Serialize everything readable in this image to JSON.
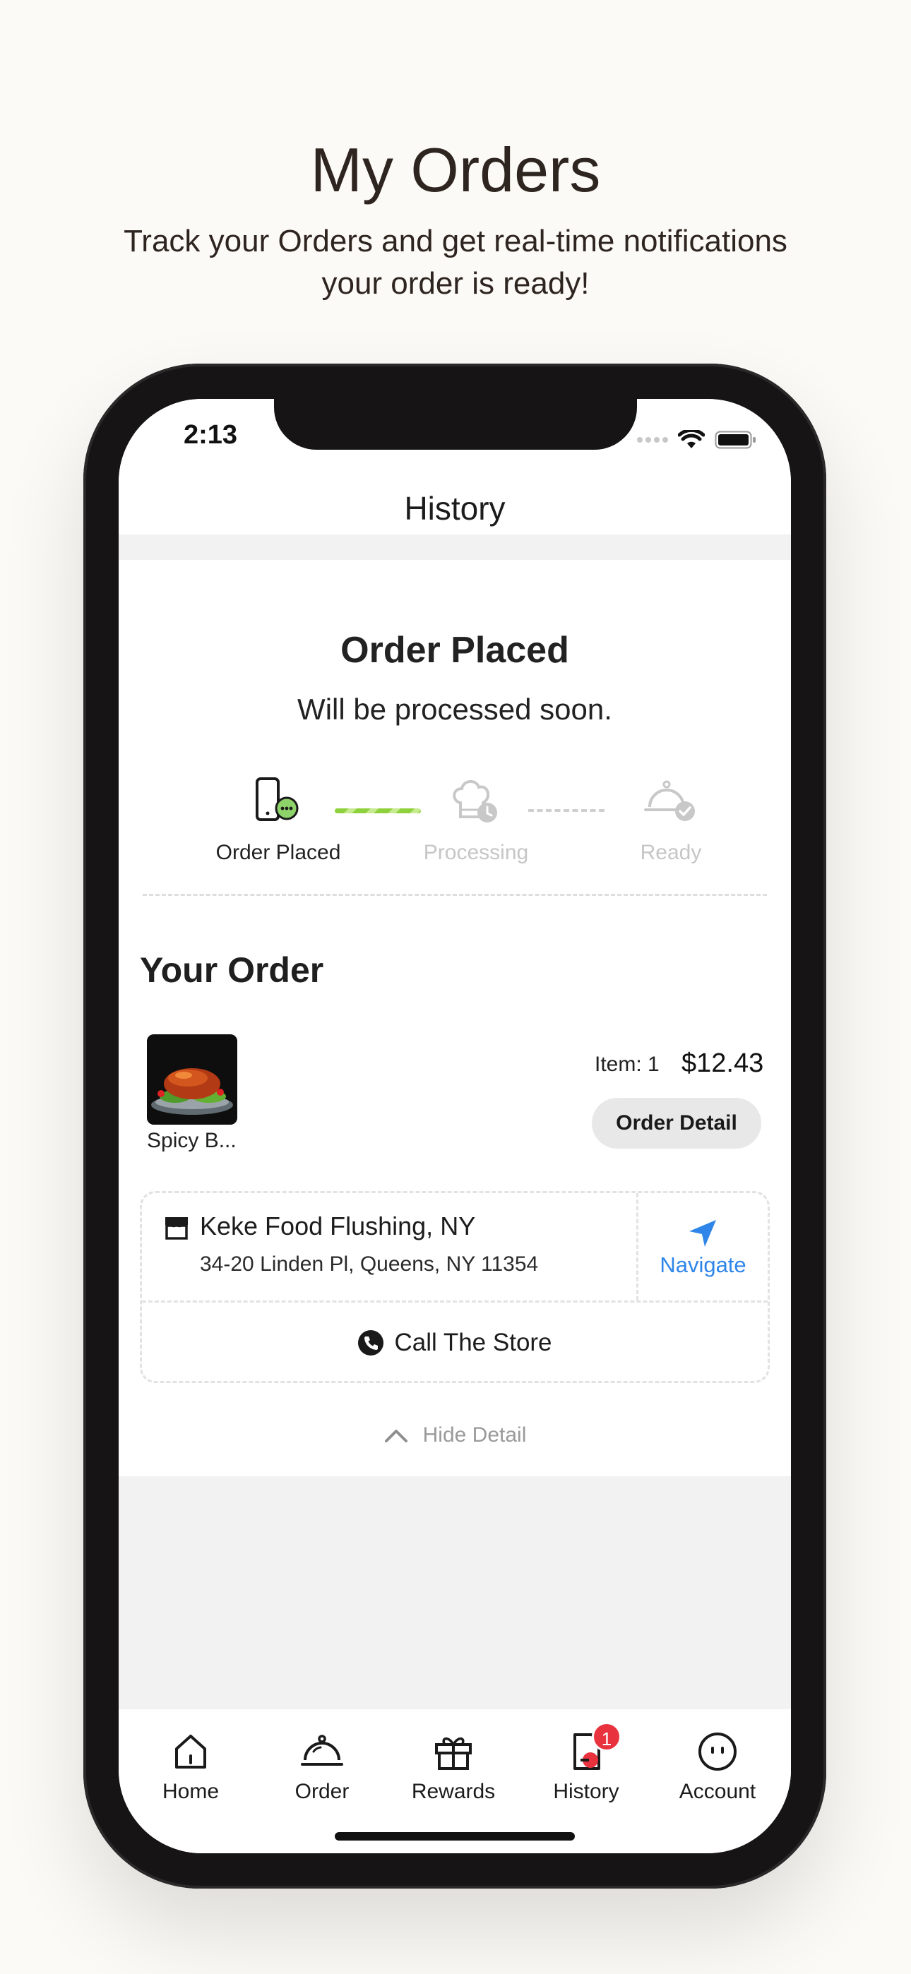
{
  "promo": {
    "title": "My Orders",
    "subtitle_line1": "Track your Orders and get real-time notifications",
    "subtitle_line2": "your order is ready!"
  },
  "status_bar": {
    "time": "2:13"
  },
  "nav": {
    "title": "History"
  },
  "order_status": {
    "heading": "Order Placed",
    "message": "Will be processed soon.",
    "steps": [
      {
        "label": "Order Placed",
        "icon": "phone-chat-icon",
        "state": "done"
      },
      {
        "label": "Processing",
        "icon": "chef-hat-clock-icon",
        "state": "pending"
      },
      {
        "label": "Ready",
        "icon": "cloche-check-icon",
        "state": "pending"
      }
    ]
  },
  "your_order": {
    "title": "Your Order",
    "item_name": "Spicy B...",
    "item_count": "Item: 1",
    "price": "$12.43",
    "detail_button": "Order Detail"
  },
  "store": {
    "name": "Keke Food Flushing, NY",
    "address": "34-20 Linden Pl, Queens, NY 11354",
    "navigate_label": "Navigate",
    "call_label": "Call The Store"
  },
  "hide_detail": "Hide Detail",
  "tabs": [
    {
      "label": "Home",
      "icon": "home-icon"
    },
    {
      "label": "Order",
      "icon": "cloche-icon"
    },
    {
      "label": "Rewards",
      "icon": "gift-icon"
    },
    {
      "label": "History",
      "icon": "receipt-icon",
      "badge": "1"
    },
    {
      "label": "Account",
      "icon": "account-icon"
    }
  ],
  "colors": {
    "accent_blue": "#2f86e8",
    "progress_green": "#8fd13d",
    "badge_red": "#e8333f"
  }
}
